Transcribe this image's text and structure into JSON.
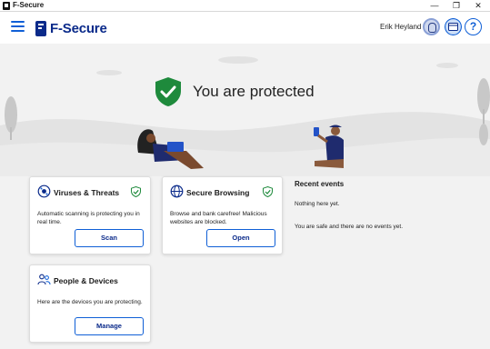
{
  "window": {
    "title": "F-Secure",
    "controls": [
      "—",
      "❐",
      "✕"
    ]
  },
  "header": {
    "brand": "F-Secure",
    "user_name": "Erik Heyland"
  },
  "status": {
    "text": "You are protected"
  },
  "cards": {
    "viruses": {
      "title": "Viruses & Threats",
      "desc_line1": "Automatic scanning is protecting you in",
      "desc_line2": "real time.",
      "button": "Scan"
    },
    "browsing": {
      "title": "Secure Browsing",
      "desc_line1": "Browse and bank carefree! Malicious",
      "desc_line2": "websites are blocked.",
      "button": "Open"
    },
    "people": {
      "title": "People & Devices",
      "desc_line1": "Here are the devices you are protecting.",
      "button": "Manage"
    }
  },
  "events": {
    "title": "Recent events",
    "line1": "Nothing here yet.",
    "line2": "You are safe and there are no events yet."
  },
  "colors": {
    "accent": "#0f5fd6",
    "brand": "#0a2a8a",
    "protected_green": "#1e8a3c",
    "background": "#f2f2f2"
  },
  "icons": {
    "menu": "hamburger-icon",
    "avatar": "user-avatar-icon",
    "cards": "subscription-cards-icon",
    "help": "help-icon",
    "shield": "shield-check-icon",
    "virus": "virus-icon",
    "globe": "globe-icon",
    "people": "people-icon"
  }
}
